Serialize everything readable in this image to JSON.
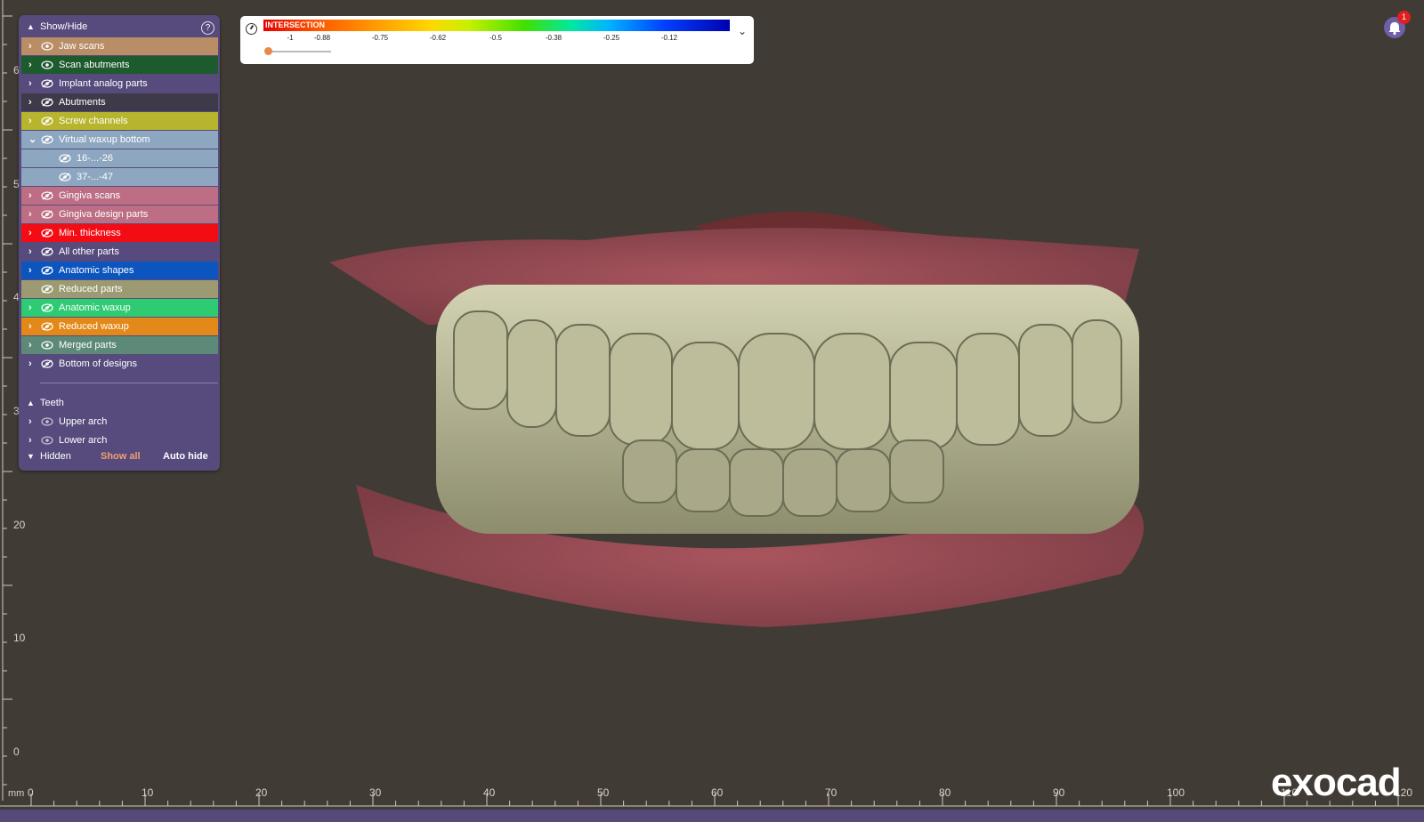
{
  "colors": {
    "background": "#413b35",
    "panel": "#574b7d",
    "accent": "#e8894a"
  },
  "panel": {
    "header": "Show/Hide",
    "items": [
      {
        "label": "Jaw scans",
        "color": "#b98d65",
        "visible": true
      },
      {
        "label": "Scan abutments",
        "color": "#1d5a2e",
        "visible": true
      },
      {
        "label": "Implant analog parts",
        "color": "#574b7d",
        "visible": false
      },
      {
        "label": "Abutments",
        "color": "#3f3a4a",
        "visible": false
      },
      {
        "label": "Screw channels",
        "color": "#b7b42d",
        "visible": false
      },
      {
        "label": "Virtual waxup bottom",
        "color": "#8ea7c0",
        "visible": false,
        "expanded": true
      },
      {
        "label": "16-...-26",
        "color": "#8ea7c0",
        "visible": false,
        "sub": true
      },
      {
        "label": "37-...-47",
        "color": "#8ea7c0",
        "visible": false,
        "sub": true
      },
      {
        "label": "Gingiva scans",
        "color": "#bd6e84",
        "visible": false
      },
      {
        "label": "Gingiva design parts",
        "color": "#bd6e84",
        "visible": false
      },
      {
        "label": "Min. thickness",
        "color": "#f40c14",
        "visible": false
      },
      {
        "label": "All other parts",
        "color": "#574b7d",
        "visible": false
      },
      {
        "label": "Anatomic shapes",
        "color": "#0c55bf",
        "visible": false
      },
      {
        "label": "Reduced parts",
        "color": "#9c9a72",
        "visible": false,
        "noexp": true
      },
      {
        "label": "Anatomic waxup",
        "color": "#2ecb72",
        "visible": false
      },
      {
        "label": "Reduced waxup",
        "color": "#e2891a",
        "visible": false
      },
      {
        "label": "Merged parts",
        "color": "#5d8a77",
        "visible": true
      },
      {
        "label": "Bottom of designs",
        "color": "#574b7d",
        "visible": false
      }
    ],
    "teeth": {
      "header": "Teeth",
      "items": [
        "Upper arch",
        "Lower arch"
      ]
    },
    "hidden": {
      "label": "Hidden",
      "show_all": "Show all",
      "auto_hide": "Auto hide"
    }
  },
  "colorbar": {
    "title": "INTERSECTION",
    "ticks": [
      "-1",
      "-0.88",
      "-0.75",
      "-0.62",
      "-0.5",
      "-0.38",
      "-0.25",
      "-0.12"
    ],
    "slider_value": 0
  },
  "notifications": {
    "count": "1"
  },
  "rulers": {
    "unit": "mm",
    "bottom": [
      "0",
      "10",
      "20",
      "30",
      "40",
      "50",
      "60",
      "70",
      "80",
      "90",
      "100",
      "110",
      "120"
    ],
    "left": [
      "6",
      "5",
      "4",
      "3",
      "20",
      "10",
      "0"
    ]
  },
  "logo": "exocad"
}
